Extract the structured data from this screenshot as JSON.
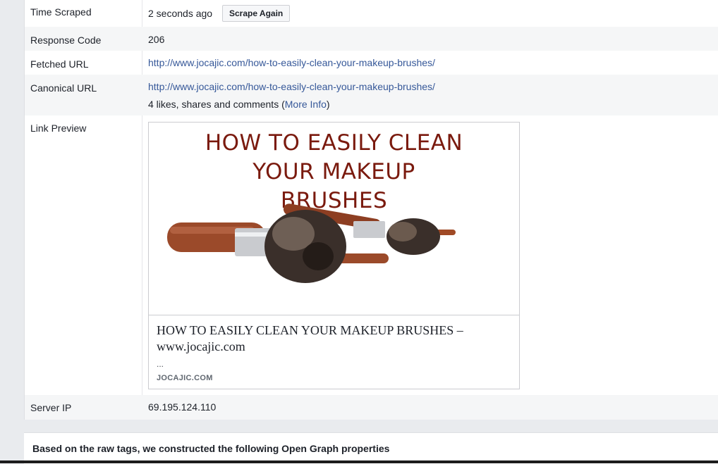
{
  "rows": {
    "time_scraped": {
      "label": "Time Scraped",
      "value": "2 seconds ago",
      "button": "Scrape Again"
    },
    "response_code": {
      "label": "Response Code",
      "value": "206"
    },
    "fetched_url": {
      "label": "Fetched URL",
      "value": "http://www.jocajic.com/how-to-easily-clean-your-makeup-brushes/"
    },
    "canonical_url": {
      "label": "Canonical URL",
      "value": "http://www.jocajic.com/how-to-easily-clean-your-makeup-brushes/",
      "engagement": "4 likes, shares and comments (",
      "more_info": "More Info",
      "close_paren": ")"
    },
    "link_preview": {
      "label": "Link Preview",
      "image_title_lines": [
        "HOW TO EASILY CLEAN",
        "YOUR MAKEUP",
        "BRUSHES"
      ],
      "title": "HOW TO EASILY CLEAN YOUR MAKEUP BRUSHES – www.jocajic.com",
      "description": "...",
      "domain": "JOCAJIC.COM"
    },
    "server_ip": {
      "label": "Server IP",
      "value": "69.195.124.110"
    }
  },
  "footer": {
    "text": "Based on the raw tags, we constructed the following Open Graph properties"
  },
  "colors": {
    "link": "#365899",
    "image_title": "#7a1a0e",
    "brush_handle": "#9b4a2a",
    "brush_ferrule": "#c9cbcf",
    "bristle": "#3a2f2a"
  }
}
